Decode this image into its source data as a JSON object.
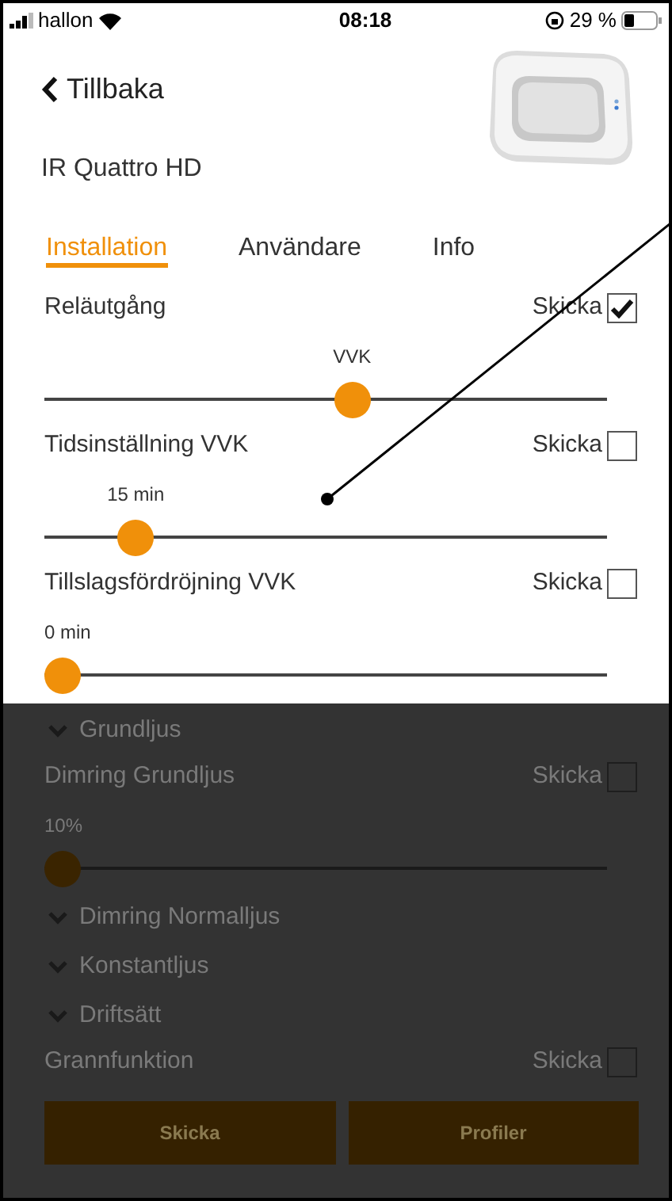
{
  "status_bar": {
    "carrier": "hallon",
    "time": "08:18",
    "battery": "29 %"
  },
  "back": {
    "label": "Tillbaka"
  },
  "device": {
    "name": "IR Quattro HD"
  },
  "tabs": [
    {
      "label": "Installation",
      "selected": true
    },
    {
      "label": "Användare",
      "selected": false
    },
    {
      "label": "Info",
      "selected": false
    }
  ],
  "sections": [
    {
      "dimmed": false,
      "items": [
        {
          "kind": "setting",
          "label": "Reläutgång",
          "send_label": "Skicka",
          "checked": true,
          "value": "VVK",
          "level": 0.55
        },
        {
          "kind": "setting",
          "label": "Tidsinställning VVK",
          "send_label": "Skicka",
          "checked": false,
          "value": "15 min",
          "level": 0.14
        },
        {
          "kind": "setting",
          "label": "Tillslagsfördröjning VVK",
          "send_label": "Skicka",
          "checked": false,
          "value": "0 min",
          "level": 0
        }
      ]
    },
    {
      "dimmed": true,
      "items": [
        {
          "kind": "group",
          "label": "Grundljus",
          "expanded": false
        },
        {
          "kind": "setting",
          "label": "Dimring Grundljus",
          "send_label": "Skicka",
          "checked": false,
          "value": "10%",
          "level": 0
        },
        {
          "kind": "group",
          "label": "Dimring Normalljus",
          "expanded": false
        },
        {
          "kind": "group",
          "label": "Konstantljus",
          "expanded": false
        },
        {
          "kind": "group",
          "label": "Driftsätt",
          "expanded": false
        },
        {
          "kind": "toggle",
          "label": "Grannfunktion",
          "send_label": "Skicka",
          "checked": false
        }
      ],
      "buttons": [
        "Skicka",
        "Profiler"
      ]
    }
  ]
}
